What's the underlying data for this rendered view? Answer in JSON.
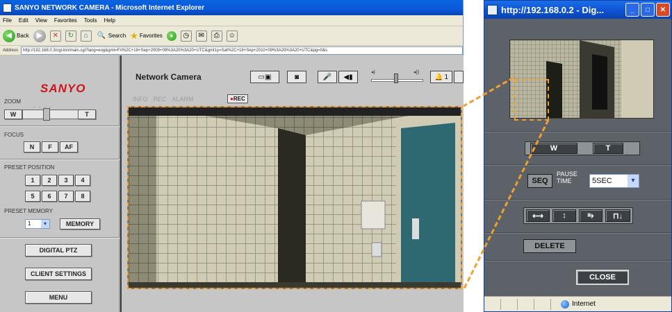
{
  "ie_window": {
    "title": "SANYO NETWORK CAMERA - Microsoft Internet Explorer",
    "menu": [
      "File",
      "Edit",
      "View",
      "Favorites",
      "Tools",
      "Help"
    ],
    "toolbar": {
      "back": "Back",
      "search": "Search",
      "favorites": "Favorites"
    },
    "address_label": "Address",
    "address_url": "http://192.168.0.3/cgi-bin/main.cgi?lang=eng&gmt=Fri%2C+18+Sep+2009+09%3A20%3A20+UTC&gmt1y=Sat%2C+18+Sep+2010+09%3A20%3A20+UTC&pg=0&s"
  },
  "side_panel": {
    "logo": "SANYO",
    "zoom_label": "ZOOM",
    "zoom_wide": "W",
    "zoom_tele": "T",
    "focus_label": "FOCUS",
    "focus_buttons": [
      "N",
      "F",
      "AF"
    ],
    "preset_position_label": "PRESET POSITION",
    "preset_buttons": [
      "1",
      "2",
      "3",
      "4",
      "5",
      "6",
      "7",
      "8"
    ],
    "preset_memory_label": "PRESET MEMORY",
    "preset_memory_value": "1",
    "memory_button": "MEMORY",
    "digital_ptz": "DIGITAL PTZ",
    "client_settings": "CLIENT SETTINGS",
    "menu_button": "MENU"
  },
  "main_panel": {
    "title": "Network Camera",
    "tabs": [
      "INFO",
      "REC",
      "ALARM"
    ],
    "rec_label": "REC",
    "alarm_button": "1"
  },
  "popup": {
    "title": "http://192.168.0.2 - Dig...",
    "zoom_wide": "W",
    "zoom_tele": "T",
    "seq_button": "SEQ",
    "pause_label_1": "PAUSE",
    "pause_label_2": "TIME",
    "pause_value": "5SEC",
    "delete_button": "DELETE",
    "close_button": "CLOSE",
    "status_text": "Internet"
  },
  "colors": {
    "callout": "#f0a030",
    "sanyo_red": "#d0121b"
  }
}
